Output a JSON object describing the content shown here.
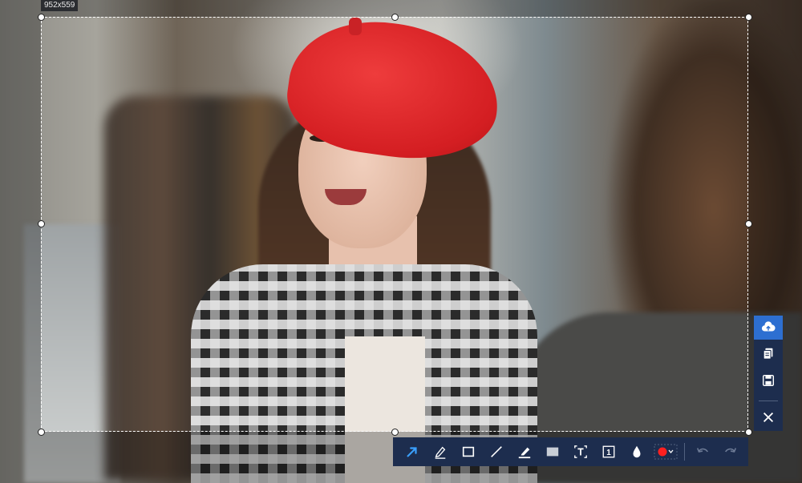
{
  "selection": {
    "size_label": "952x559"
  },
  "toolbar": {
    "tools": [
      {
        "name": "arrow",
        "icon": "arrow-icon",
        "active": true
      },
      {
        "name": "pen",
        "icon": "pen-icon"
      },
      {
        "name": "rectangle",
        "icon": "rectangle-icon"
      },
      {
        "name": "line",
        "icon": "line-icon"
      },
      {
        "name": "highlighter",
        "icon": "highlighter-icon"
      },
      {
        "name": "blur",
        "icon": "blur-icon"
      },
      {
        "name": "text",
        "icon": "text-icon"
      },
      {
        "name": "step-number",
        "icon": "step-number-icon",
        "label": "1"
      },
      {
        "name": "fill",
        "icon": "drop-icon"
      },
      {
        "name": "color",
        "icon": "color-picker-icon",
        "color": "#ff2020"
      },
      {
        "name": "undo",
        "icon": "undo-icon"
      },
      {
        "name": "redo",
        "icon": "redo-icon"
      }
    ],
    "accent_color": "#3aa0ff"
  },
  "sidebar": {
    "buttons": [
      {
        "name": "upload",
        "icon": "cloud-upload-icon"
      },
      {
        "name": "copy",
        "icon": "copy-icon"
      },
      {
        "name": "save",
        "icon": "save-icon"
      },
      {
        "name": "close",
        "icon": "close-icon"
      }
    ]
  }
}
